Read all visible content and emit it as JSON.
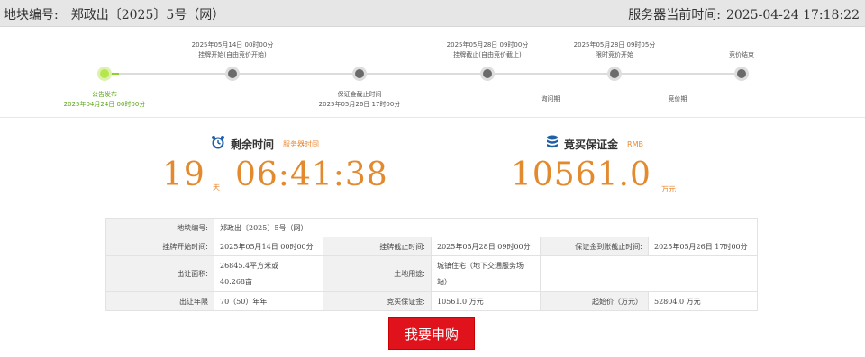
{
  "header": {
    "parcel_label": "地块编号:",
    "parcel_value": "郑政出〔2025〕5号（网）",
    "server_time_label": "服务器当前时间:",
    "server_time_value": "2025-04-24 17:18:22"
  },
  "timeline": {
    "steps": [
      {
        "label": "公告发布",
        "time": "2025年04月24日 00时00分",
        "state": "done"
      },
      {
        "label": "挂牌开始(自由竞价开始)",
        "time": "2025年05月14日 00时00分",
        "state": "pending"
      },
      {
        "label": "保证金截止时间",
        "time": "2025年05月26日 17时00分",
        "state": "pending"
      },
      {
        "label": "挂牌截止(自由竞价截止)",
        "time": "2025年05月28日 09时00分",
        "state": "pending"
      },
      {
        "label": "限时竞价开始",
        "time": "2025年05月28日 09时05分",
        "state": "pending"
      },
      {
        "label": "竞价结束",
        "time": "",
        "state": "pending"
      }
    ],
    "phases": [
      "询问期",
      "竞价期"
    ]
  },
  "countdown": {
    "title": "剩余时间",
    "subtitle": "服务器时间",
    "days": "19",
    "days_unit": "天",
    "time": "06:41:38"
  },
  "deposit": {
    "title": "竞买保证金",
    "subtitle": "RMB",
    "amount": "10561.0",
    "unit": "万元"
  },
  "info": {
    "parcel_label": "地块编号:",
    "parcel_value": "郑政出〔2025〕5号（网）",
    "listing_start_label": "挂牌开始时间:",
    "listing_start_value": "2025年05月14日 00时00分",
    "listing_end_label": "挂牌截止时间:",
    "listing_end_value": "2025年05月28日 09时00分",
    "deposit_deadline_label": "保证金到账截止时间:",
    "deposit_deadline_value": "2025年05月26日 17时00分",
    "area_label": "出让面积:",
    "area_value_1": "26845.4平方米或",
    "area_value_2": "40.268亩",
    "usage_label": "土地用途:",
    "usage_value_1": "城镇住宅（地下交通服务场",
    "usage_value_2": "站）",
    "term_label": "出让年限",
    "term_value": "70（50）年年",
    "deposit_label": "竞买保证金:",
    "deposit_value": "10561.0 万元",
    "start_price_label": "起始价（万元）",
    "start_price_value": "52804.0 万元"
  },
  "actions": {
    "apply_label": "我要申购"
  },
  "colors": {
    "accent_orange": "#e38a2e",
    "active_green": "#8fce2b",
    "button_red": "#e0121b"
  }
}
